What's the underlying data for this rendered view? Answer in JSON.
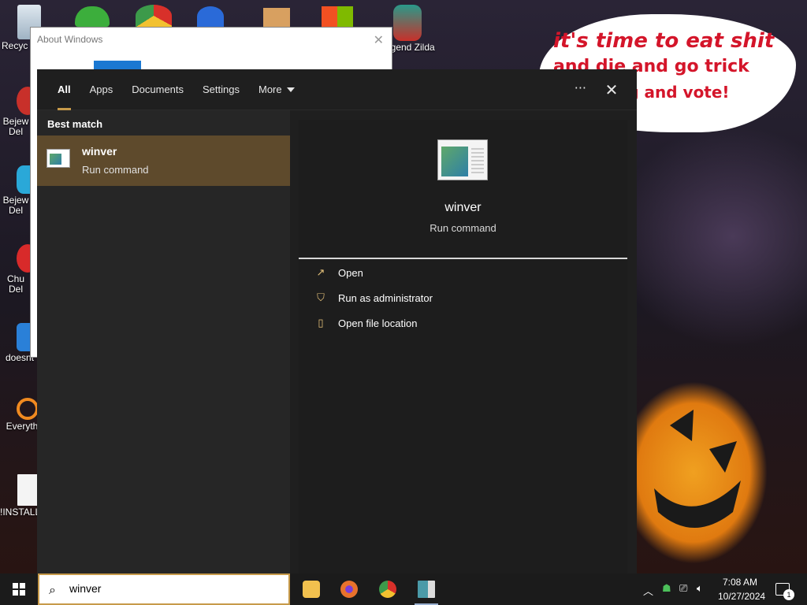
{
  "desktop": {
    "wallpaper_text": {
      "line1": "it's time to eat shit",
      "line2": "and die and go trick",
      "line3": "ng and vote!"
    },
    "icons": [
      {
        "label": "Recyc",
        "icon": "recycle-bin-icon"
      },
      {
        "label": "Bejew Del",
        "icon": "bejeweled-icon"
      },
      {
        "label": "Bejew Del",
        "icon": "bejeweled-icon"
      },
      {
        "label": "Chu Del",
        "icon": "chuzzle-icon"
      },
      {
        "label": "doesnt",
        "icon": "shortcut-icon"
      },
      {
        "label": "Everyth",
        "icon": "everything-search-icon"
      },
      {
        "label": "!INSTALL",
        "icon": "document-icon"
      },
      {
        "label": "Legend Zilda",
        "icon": "game-character-icon"
      }
    ]
  },
  "about_window": {
    "title": "About Windows",
    "close_glyph": "✕"
  },
  "search_flyout": {
    "tabs": [
      {
        "label": "All",
        "active": true
      },
      {
        "label": "Apps"
      },
      {
        "label": "Documents"
      },
      {
        "label": "Settings"
      },
      {
        "label": "More"
      }
    ],
    "ellipsis": "···",
    "close_glyph": "✕",
    "best_match_label": "Best match",
    "best_match": {
      "name": "winver",
      "type": "Run command"
    },
    "preview": {
      "name": "winver",
      "type": "Run command"
    },
    "actions": [
      {
        "label": "Open",
        "icon": "open-icon",
        "glyph": "↗"
      },
      {
        "label": "Run as administrator",
        "icon": "shield-icon",
        "glyph": "⛉"
      },
      {
        "label": "Open file location",
        "icon": "file-location-icon",
        "glyph": "▯"
      }
    ]
  },
  "taskbar": {
    "search_value": "winver",
    "apps": [
      {
        "name": "file-explorer",
        "color": "#f2c14e"
      },
      {
        "name": "firefox",
        "color": "#e8722c"
      },
      {
        "name": "chrome",
        "color": "#3c9a4a"
      },
      {
        "name": "winver",
        "color": "#dcdcdc"
      }
    ],
    "time": "7:08 AM",
    "date": "10/27/2024",
    "notification_count": "1"
  },
  "colors": {
    "accent": "#c79a4a",
    "selected_result": "#5e4a2c",
    "flyout_bg": "#1f1f1f"
  }
}
